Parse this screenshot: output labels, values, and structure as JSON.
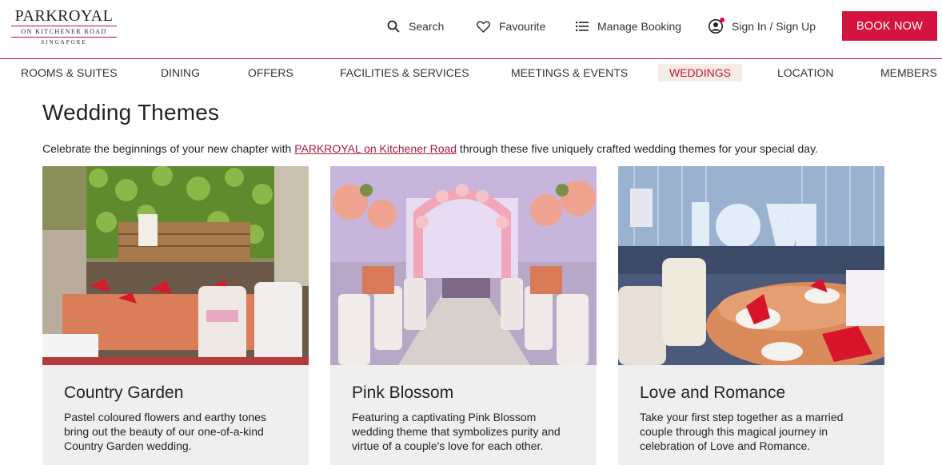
{
  "brand": {
    "name": "PARKROYAL",
    "subtitle": "ON KITCHENER ROAD",
    "city": "SINGAPORE",
    "accent": "#d4143c",
    "nav_accent": "#c41539"
  },
  "header": {
    "search_label": "Search",
    "favourite_label": "Favourite",
    "manage_label": "Manage Booking",
    "sign_label": "Sign In / Sign Up",
    "book_label": "BOOK NOW"
  },
  "nav": {
    "items": [
      {
        "label": "ROOMS & SUITES"
      },
      {
        "label": "DINING"
      },
      {
        "label": "OFFERS"
      },
      {
        "label": "FACILITIES & SERVICES"
      },
      {
        "label": "MEETINGS & EVENTS"
      },
      {
        "label": "WEDDINGS",
        "active": true
      },
      {
        "label": "LOCATION"
      },
      {
        "label": "MEMBERS"
      }
    ]
  },
  "main": {
    "title": "Wedding Themes",
    "intro_before": "Celebrate the beginnings of your new chapter with ",
    "intro_link": "PARKROYAL on Kitchener Road",
    "intro_after": " through these five uniquely crafted wedding themes for your special day."
  },
  "cards": [
    {
      "title": "Country Garden",
      "desc": "Pastel coloured flowers and earthy tones bring out the beauty of our one-of-a-kind Country Garden wedding."
    },
    {
      "title": "Pink Blossom",
      "desc": "Featuring a captivating Pink Blossom wedding theme that symbolizes purity and virtue of a couple's love for each other."
    },
    {
      "title": "Love and Romance",
      "desc": "Take your first step together as a married couple through this magical journey in celebration of Love and Romance."
    }
  ],
  "icons": {
    "search": "search-icon",
    "favourite": "heart-icon",
    "manage": "list-icon",
    "sign": "user-icon"
  }
}
